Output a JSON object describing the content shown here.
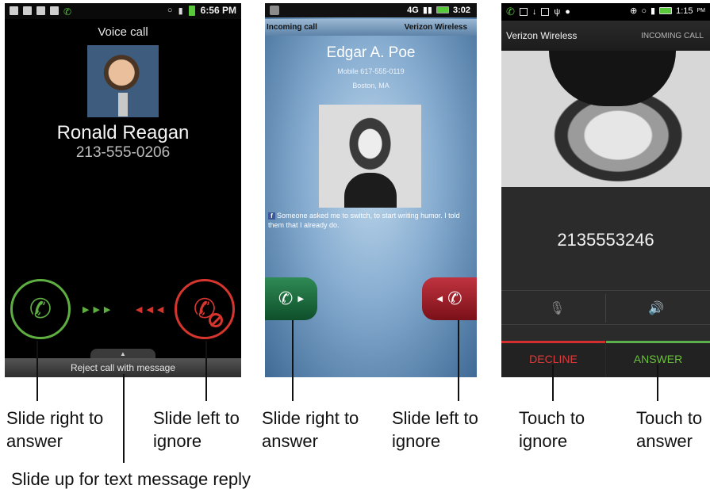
{
  "phone1": {
    "status_time": "6:56 PM",
    "title": "Voice call",
    "caller_name": "Ronald Reagan",
    "caller_number": "213-555-0206",
    "reject_label": "Reject call with message",
    "colors": {
      "answer": "#5fae41",
      "ignore": "#d6352e"
    }
  },
  "phone2": {
    "status_network": "4G",
    "status_time": "3:02",
    "incoming_label": "Incoming call",
    "carrier": "Verizon Wireless",
    "caller_name": "Edgar A. Poe",
    "caller_mobile": "Mobile 617-555-0119",
    "caller_city": "Boston, MA",
    "fb_badge": "f",
    "social_status": "Someone asked me to switch, to start writing humor. I told them that I already do."
  },
  "phone3": {
    "status_time": "1:15",
    "status_ampm": "PM",
    "carrier": "Verizon Wireless",
    "incoming_label": "INCOMING CALL",
    "caller_number": "2135553246",
    "decline_label": "DECLINE",
    "answer_label": "ANSWER",
    "colors": {
      "decline": "#d42f2f",
      "answer": "#5bb04d"
    }
  },
  "callouts": {
    "p1_answer_1": "Slide right to",
    "p1_answer_2": "answer",
    "p1_ignore_1": "Slide left to",
    "p1_ignore_2": "ignore",
    "p1_text_reply": "Slide up for text message reply",
    "p2_answer_1": "Slide right to",
    "p2_answer_2": "answer",
    "p2_ignore_1": "Slide left to",
    "p2_ignore_2": "ignore",
    "p3_ignore_1": "Touch to",
    "p3_ignore_2": "ignore",
    "p3_answer_1": "Touch to",
    "p3_answer_2": "answer"
  }
}
